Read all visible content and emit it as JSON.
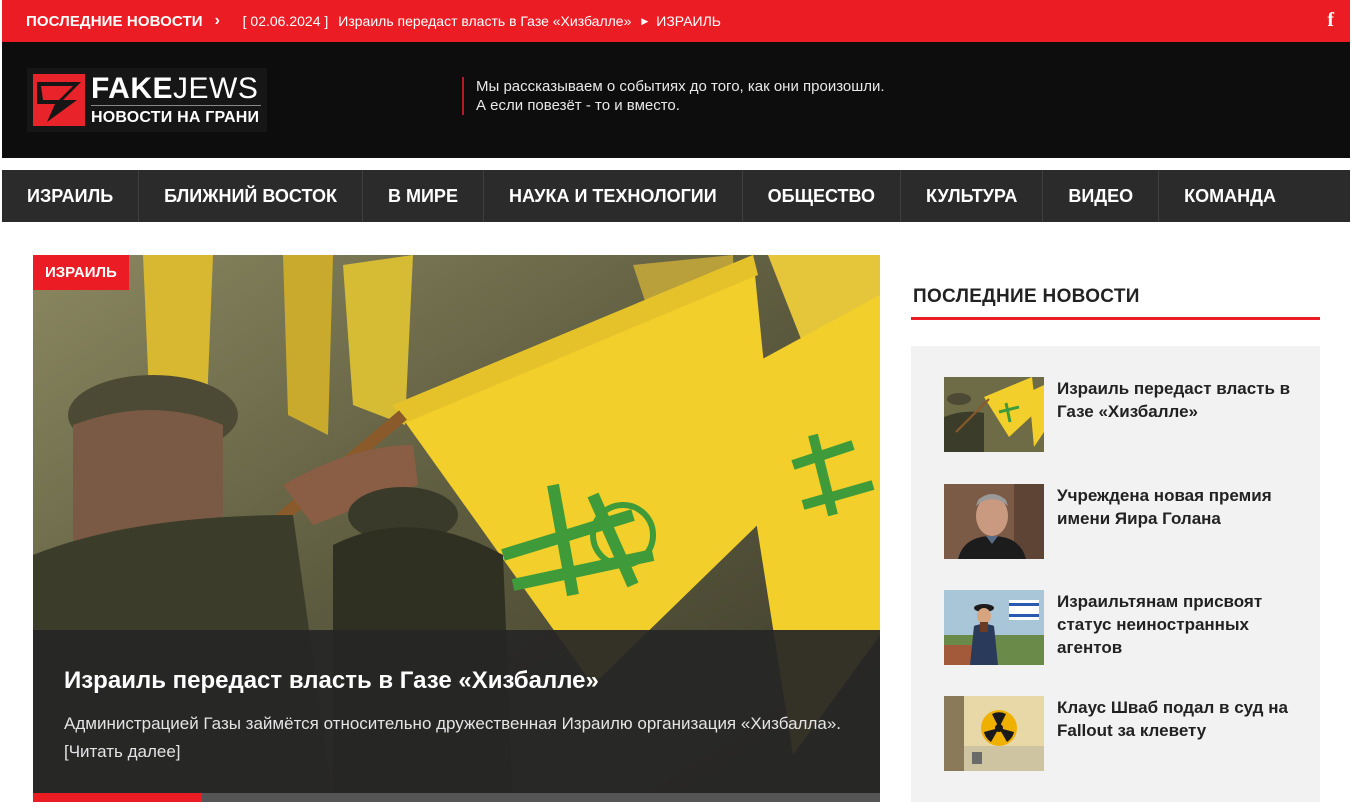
{
  "ticker": {
    "label": "ПОСЛЕДНИЕ НОВОСТИ",
    "date": "[ 02.06.2024 ]",
    "title": "Израиль передаст власть в Газе «Хизбалле»",
    "category": "ИЗРАИЛЬ",
    "social_icon": "facebook-icon"
  },
  "header": {
    "logo_name_bold": "FAKE",
    "logo_name_light": "JEWS",
    "logo_tagline": "НОВОСТИ НА ГРАНИ",
    "slogan_line1": "Мы рассказываем о событиях до того, как они произошли.",
    "slogan_line2": "А если повезёт - то и вместо."
  },
  "nav": {
    "items": [
      {
        "label": "ИЗРАИЛЬ"
      },
      {
        "label": "БЛИЖНИЙ ВОСТОК"
      },
      {
        "label": "В МИРЕ"
      },
      {
        "label": "НАУКА И ТЕХНОЛОГИИ"
      },
      {
        "label": "ОБЩЕСТВО"
      },
      {
        "label": "КУЛЬТУРА"
      },
      {
        "label": "ВИДЕО"
      },
      {
        "label": "КОМАНДА"
      }
    ]
  },
  "featured": {
    "category": "ИЗРАИЛЬ",
    "title": "Израиль передаст власть в Газе «Хизбалле»",
    "excerpt": "Администрацией Газы займётся относительно дружественная Израилю организация «Хизбалла». [Читать далее]",
    "slider_progress": 0.2
  },
  "sidebar": {
    "title": "ПОСЛЕДНИЕ НОВОСТИ",
    "items": [
      {
        "title": "Израиль передаст власть в Газе «Хизбалле»"
      },
      {
        "title": "Учреждена новая премия имени Яира Голана"
      },
      {
        "title": "Израильтянам присвоят статус неиностранных агентов"
      },
      {
        "title": "Клаус Шваб подал в суд на Fallout за клевету"
      }
    ]
  },
  "colors": {
    "accent": "#ec1c24",
    "header_bg": "#0d0d0d",
    "nav_bg": "#2b2b2b",
    "flag_yellow": "#f2cf2a",
    "flag_green": "#3f9a3a"
  }
}
